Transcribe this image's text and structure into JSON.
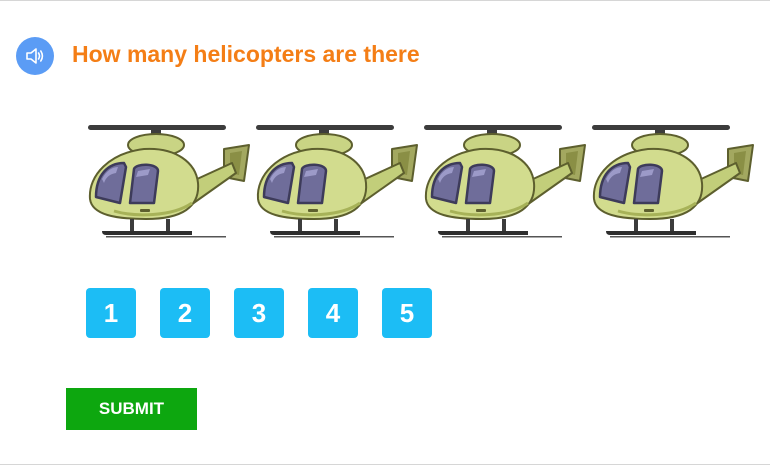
{
  "question": {
    "text": "How many helicopters are there"
  },
  "speaker": {
    "icon": "speaker-icon"
  },
  "picture": {
    "item_icon": "helicopter-icon",
    "count": 4
  },
  "options": [
    {
      "label": "1"
    },
    {
      "label": "2"
    },
    {
      "label": "3"
    },
    {
      "label": "4"
    },
    {
      "label": "5"
    }
  ],
  "submit": {
    "label": "SUBMIT"
  },
  "colors": {
    "question_text": "#f47e16",
    "speaker_bg": "#5b9cf5",
    "option_bg": "#1cbdf5",
    "submit_bg": "#0da70f"
  }
}
